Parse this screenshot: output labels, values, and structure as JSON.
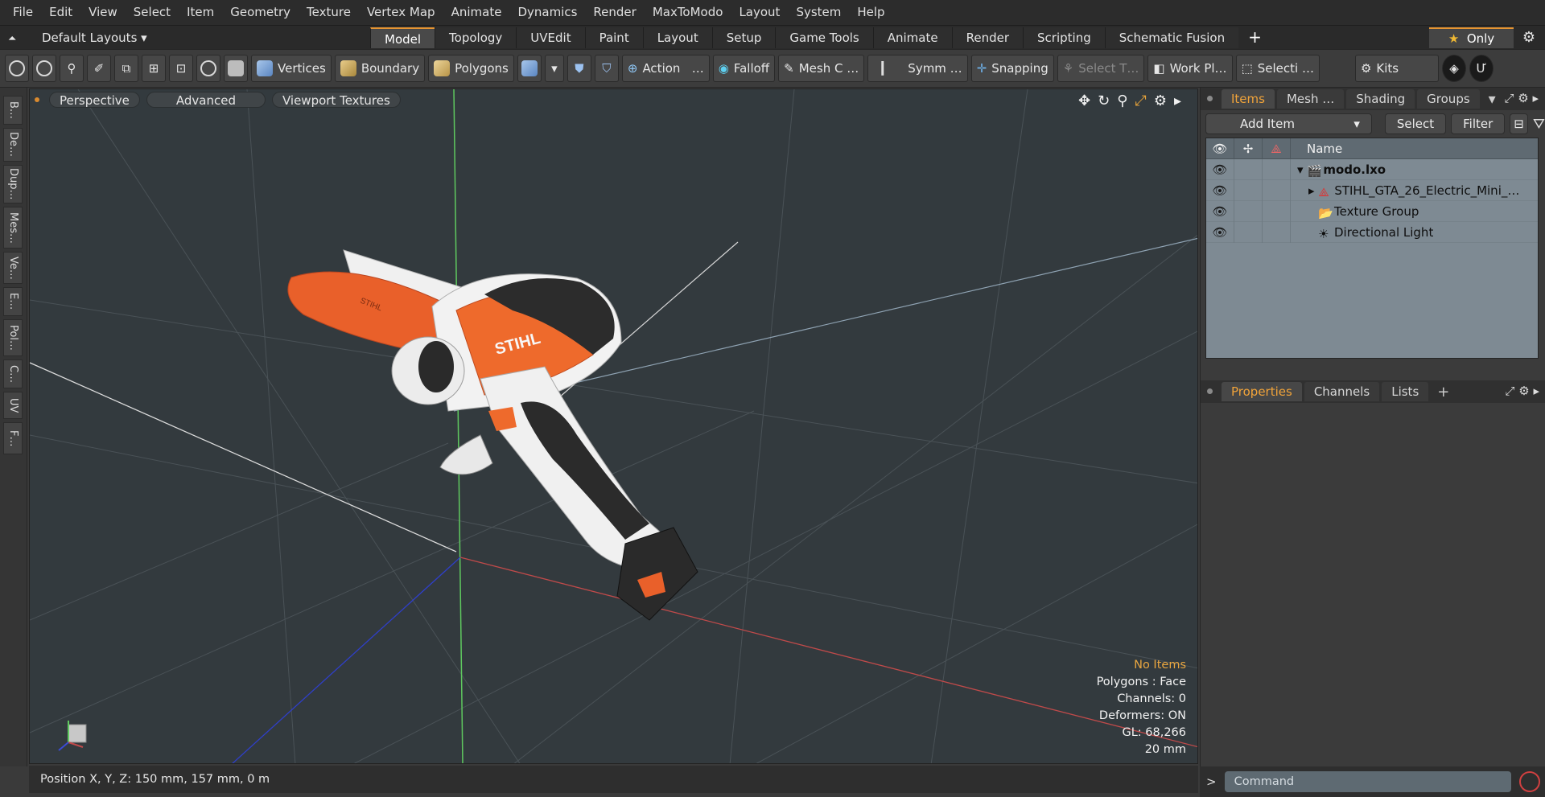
{
  "menu": [
    "File",
    "Edit",
    "View",
    "Select",
    "Item",
    "Geometry",
    "Texture",
    "Vertex Map",
    "Animate",
    "Dynamics",
    "Render",
    "MaxToModo",
    "Layout",
    "System",
    "Help"
  ],
  "layout": {
    "name": "Default Layouts ▾",
    "tabs": [
      "Model",
      "Topology",
      "UVEdit",
      "Paint",
      "Layout",
      "Setup",
      "Game Tools",
      "Animate",
      "Render",
      "Scripting",
      "Schematic Fusion"
    ],
    "active_tab": "Model",
    "only_label": "Only"
  },
  "toolbar": {
    "vertices": "Vertices",
    "boundary": "Boundary",
    "polygons": "Polygons",
    "action": "Action",
    "action_more": "…",
    "falloff": "Falloff",
    "mesh": "Mesh C …",
    "symmetry": "Symm …",
    "snapping": "Snapping",
    "select_t": "Select T…",
    "workplane": "Work Pl…",
    "selection": "Selecti …",
    "kits": "Kits"
  },
  "left_tabs": [
    "B…",
    "De…",
    "Dup…",
    "Mes…",
    "Ve…",
    "E…",
    "Pol…",
    "C…",
    "UV",
    "F…"
  ],
  "viewport": {
    "perspective": "Perspective",
    "advanced": "Advanced",
    "textures": "Viewport Textures",
    "info": {
      "selection": "No Items",
      "polygons": "Polygons : Face",
      "channels": "Channels: 0",
      "deformers": "Deformers: ON",
      "gl": "GL: 68,266",
      "scale": "20 mm"
    },
    "brand_text": "STIHL",
    "brand_small": "STIHL"
  },
  "status": {
    "position": "Position X, Y, Z:   150 mm, 157 mm, 0 m"
  },
  "panel": {
    "tabs": [
      "Items",
      "Mesh …",
      "Shading",
      "Groups"
    ],
    "active": "Items",
    "add_item": "Add Item",
    "select": "Select",
    "filter": "Filter",
    "col_name": "Name",
    "items": [
      {
        "name": "modo.lxo",
        "bold": true
      },
      {
        "name": "STIHL_GTA_26_Electric_Mini_…"
      },
      {
        "name": "Texture Group"
      },
      {
        "name": "Directional Light"
      }
    ]
  },
  "props": {
    "tabs": [
      "Properties",
      "Channels",
      "Lists"
    ],
    "active": "Properties"
  },
  "command": {
    "placeholder": "Command"
  },
  "colors": {
    "accent": "#e69533",
    "stihl_orange": "#e9602a"
  }
}
